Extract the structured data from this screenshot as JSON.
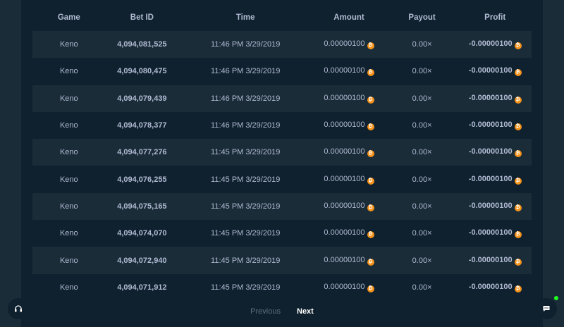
{
  "table": {
    "headers": [
      "Game",
      "Bet ID",
      "Time",
      "Amount",
      "Payout",
      "Profit"
    ],
    "currency_icon": "bitcoin-icon",
    "rows": [
      {
        "game": "Keno",
        "bet_id": "4,094,081,525",
        "time": "11:46 PM 3/29/2019",
        "amount": "0.00000100",
        "payout": "0.00×",
        "profit": "-0.00000100"
      },
      {
        "game": "Keno",
        "bet_id": "4,094,080,475",
        "time": "11:46 PM 3/29/2019",
        "amount": "0.00000100",
        "payout": "0.00×",
        "profit": "-0.00000100"
      },
      {
        "game": "Keno",
        "bet_id": "4,094,079,439",
        "time": "11:46 PM 3/29/2019",
        "amount": "0.00000100",
        "payout": "0.00×",
        "profit": "-0.00000100"
      },
      {
        "game": "Keno",
        "bet_id": "4,094,078,377",
        "time": "11:46 PM 3/29/2019",
        "amount": "0.00000100",
        "payout": "0.00×",
        "profit": "-0.00000100"
      },
      {
        "game": "Keno",
        "bet_id": "4,094,077,276",
        "time": "11:45 PM 3/29/2019",
        "amount": "0.00000100",
        "payout": "0.00×",
        "profit": "-0.00000100"
      },
      {
        "game": "Keno",
        "bet_id": "4,094,076,255",
        "time": "11:45 PM 3/29/2019",
        "amount": "0.00000100",
        "payout": "0.00×",
        "profit": "-0.00000100"
      },
      {
        "game": "Keno",
        "bet_id": "4,094,075,165",
        "time": "11:45 PM 3/29/2019",
        "amount": "0.00000100",
        "payout": "0.00×",
        "profit": "-0.00000100"
      },
      {
        "game": "Keno",
        "bet_id": "4,094,074,070",
        "time": "11:45 PM 3/29/2019",
        "amount": "0.00000100",
        "payout": "0.00×",
        "profit": "-0.00000100"
      },
      {
        "game": "Keno",
        "bet_id": "4,094,072,940",
        "time": "11:45 PM 3/29/2019",
        "amount": "0.00000100",
        "payout": "0.00×",
        "profit": "-0.00000100"
      },
      {
        "game": "Keno",
        "bet_id": "4,094,071,912",
        "time": "11:45 PM 3/29/2019",
        "amount": "0.00000100",
        "payout": "0.00×",
        "profit": "-0.00000100"
      }
    ]
  },
  "pagination": {
    "previous_label": "Previous",
    "next_label": "Next"
  },
  "widgets": {
    "support_icon": "headset-icon",
    "chat_icon": "chat-icon",
    "online_status_color": "#1fff20"
  },
  "colors": {
    "background": "#1a2c38",
    "panel": "#0f212e",
    "text_muted": "#b1bad3",
    "text_strong": "#ffffff",
    "bitcoin": "#f7931a"
  }
}
